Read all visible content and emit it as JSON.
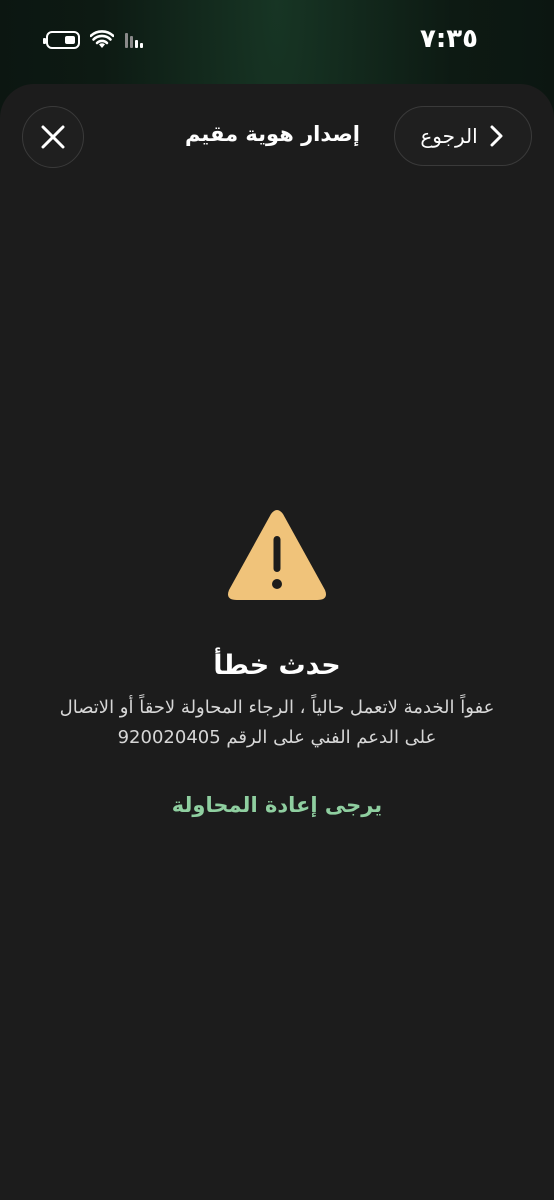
{
  "status_bar": {
    "time": "٧:٣٥",
    "icons": [
      "battery-icon",
      "wifi-icon",
      "signal-icon"
    ]
  },
  "header": {
    "back_label": "الرجوع",
    "back_icon": "chevron-right-icon",
    "title": "إصدار هوية مقيم",
    "close_icon": "close-icon"
  },
  "error": {
    "icon": "warning-triangle-icon",
    "title": "حدث خطأ",
    "message": "عفواً الخدمة لاتعمل حالياً ، الرجاء المحاولة لاحقاً أو الاتصال على الدعم الفني على الرقم 920020405",
    "retry_label": "يرجى إعادة المحاولة"
  },
  "colors": {
    "background": "#1c1c1c",
    "warning": "#f0c37a",
    "accent": "#8fcfa0",
    "text": "#ffffff"
  }
}
